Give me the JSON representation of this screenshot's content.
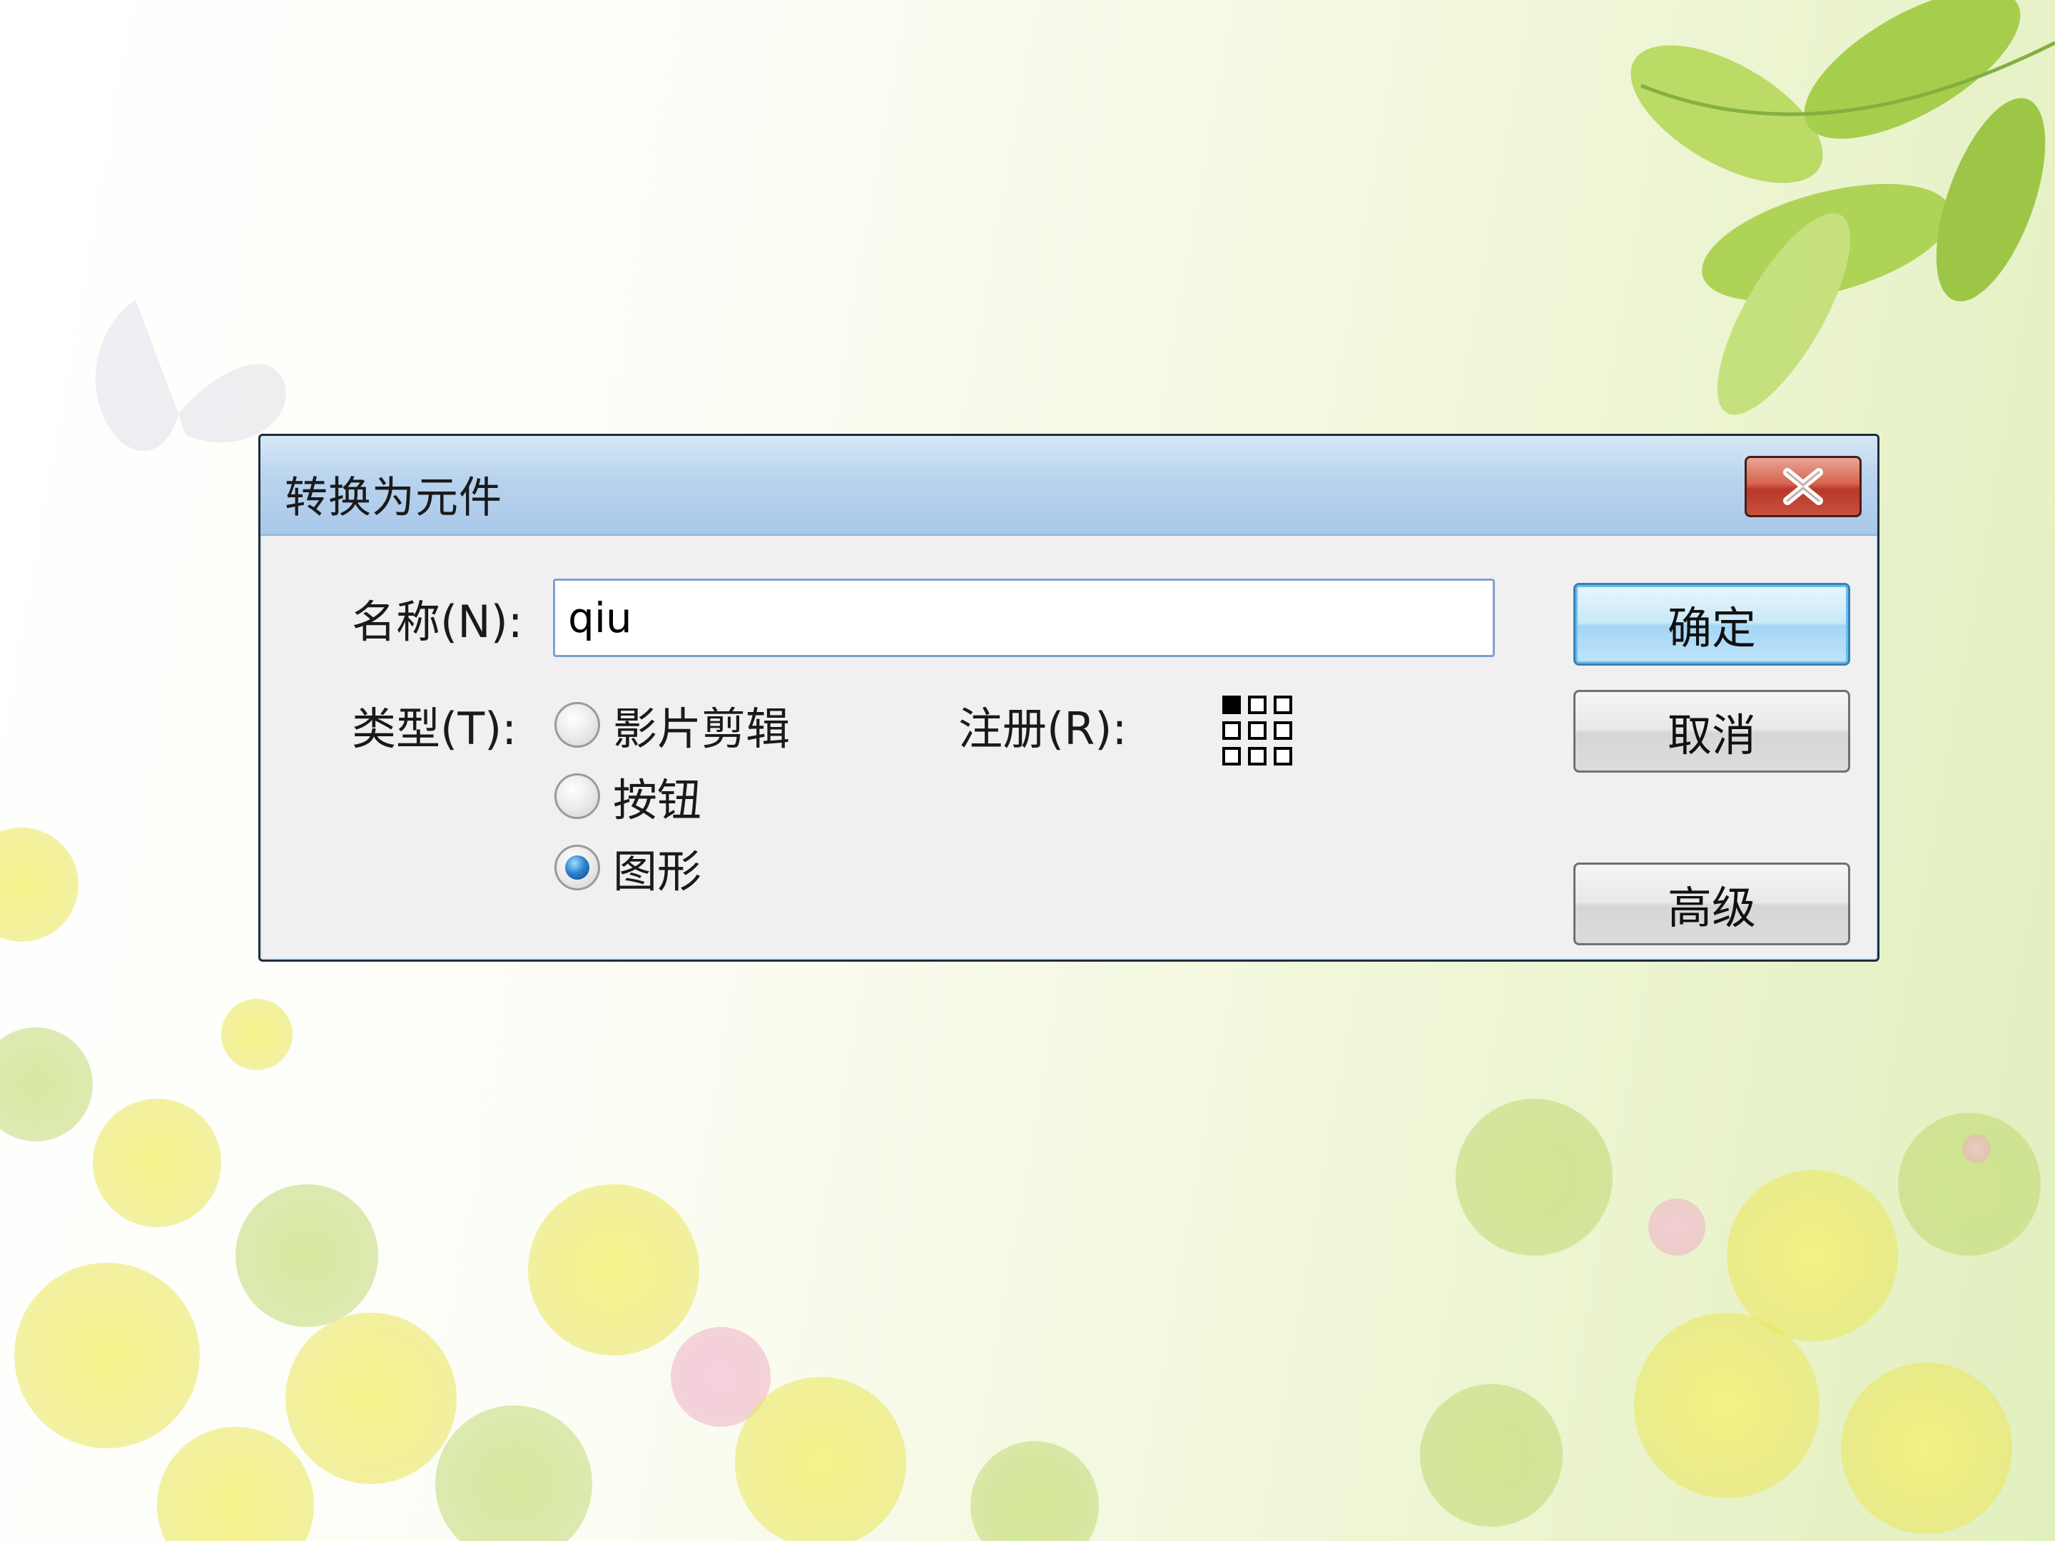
{
  "dialog": {
    "title": "转换为元件",
    "close_icon": "close-x-icon",
    "name_label": "名称(N):",
    "name_value": "qiu",
    "type_label": "类型(T):",
    "type_options": [
      "影片剪辑",
      "按钮",
      "图形"
    ],
    "type_selected": "图形",
    "registration_label": "注册(R):",
    "registration_icon": "registration-grid-icon",
    "buttons": {
      "ok": "确定",
      "cancel": "取消",
      "advanced": "高级"
    }
  },
  "colors": {
    "titlebar": "#b8d3ee",
    "close_button": "#c8513d",
    "primary_button": "#a5d6f4",
    "dialog_bg": "#f0f0f0"
  }
}
